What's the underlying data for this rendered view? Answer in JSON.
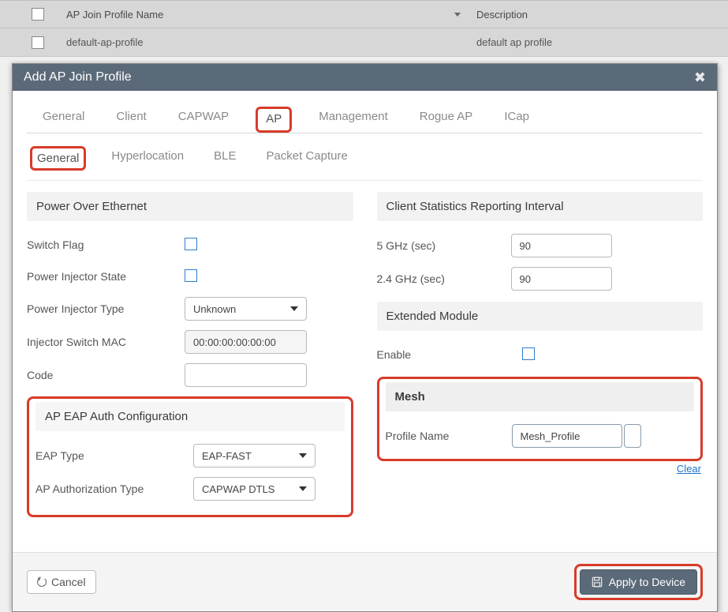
{
  "bg_table": {
    "col_name": "AP Join Profile Name",
    "col_desc": "Description",
    "row_name": "default-ap-profile",
    "row_desc": "default ap profile"
  },
  "modal_title": "Add AP Join Profile",
  "primary_tabs": {
    "general": "General",
    "client": "Client",
    "capwap": "CAPWAP",
    "ap": "AP",
    "management": "Management",
    "rogue": "Rogue AP",
    "icap": "ICap"
  },
  "secondary_tabs": {
    "general": "General",
    "hyperlocation": "Hyperlocation",
    "ble": "BLE",
    "packet_capture": "Packet Capture"
  },
  "left": {
    "poe_header": "Power Over Ethernet",
    "switch_flag": "Switch Flag",
    "power_injector_state": "Power Injector State",
    "power_injector_type": "Power Injector Type",
    "power_injector_type_value": "Unknown",
    "injector_mac": "Injector Switch MAC",
    "injector_mac_value": "00:00:00:00:00:00",
    "code": "Code",
    "code_value": "",
    "eap_header": "AP EAP Auth Configuration",
    "eap_type": "EAP Type",
    "eap_type_value": "EAP-FAST",
    "auth_type": "AP Authorization Type",
    "auth_type_value": "CAPWAP DTLS"
  },
  "right": {
    "stats_header": "Client Statistics Reporting Interval",
    "ghz5": "5 GHz (sec)",
    "ghz5_value": "90",
    "ghz24": "2.4 GHz (sec)",
    "ghz24_value": "90",
    "ext_header": "Extended Module",
    "enable": "Enable",
    "mesh_header": "Mesh",
    "profile_name": "Profile Name",
    "profile_name_value": "Mesh_Profile",
    "clear": "Clear"
  },
  "footer": {
    "cancel": "Cancel",
    "apply": "Apply to Device"
  }
}
